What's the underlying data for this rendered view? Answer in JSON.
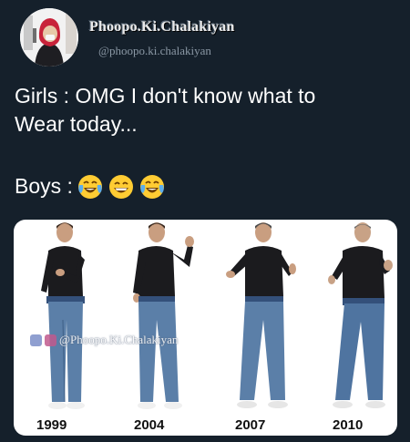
{
  "author": {
    "name": "Phoopo.Ki.Chalakiyan",
    "handle": "@phoopo.ki.chalakiyan"
  },
  "tweet": {
    "line1": "Girls : OMG I don't know what to",
    "line2": "Wear today...",
    "boys_label": "Boys :",
    "emojis": [
      "face-with-tears-of-joy-icon",
      "grinning-face-icon",
      "face-with-tears-of-joy-icon"
    ]
  },
  "media": {
    "watermark": "@Phoopo.Ki.Chalakiyan",
    "years": [
      "1999",
      "2004",
      "2007",
      "2010"
    ]
  },
  "colors": {
    "background": "#15202b",
    "text": "#ffffff",
    "secondary_text": "#8b98a5",
    "turtleneck": "#1b1b1e",
    "jeans": "#5b7fa8"
  }
}
